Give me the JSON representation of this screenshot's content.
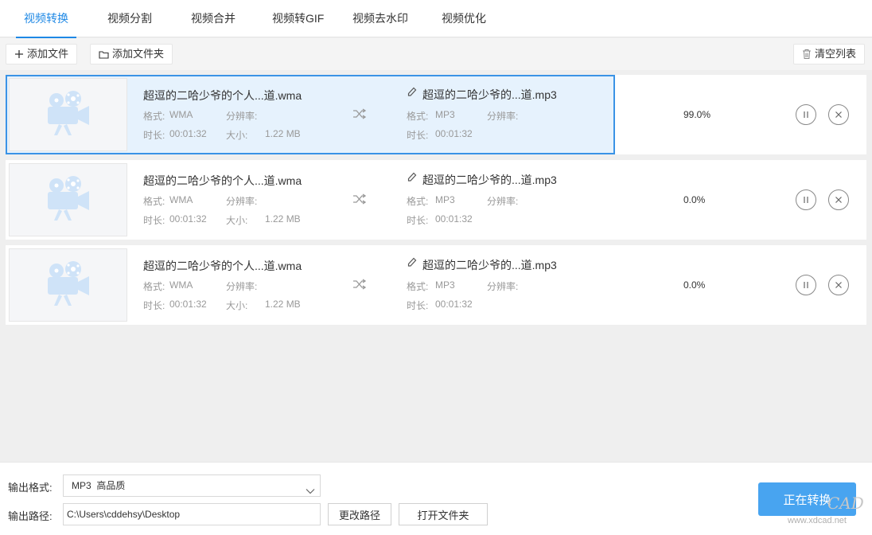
{
  "tabs": [
    {
      "label": "视频转换",
      "active": true
    },
    {
      "label": "视频分割"
    },
    {
      "label": "视频合并"
    },
    {
      "label": "视频转GIF"
    },
    {
      "label": "视频去水印"
    },
    {
      "label": "视频优化"
    }
  ],
  "toolbar": {
    "add_file": "添加文件",
    "add_folder": "添加文件夹",
    "clear_list": "清空列表"
  },
  "items": [
    {
      "source_name": "超逗的二哈少爷的个人...道.wma",
      "format_label": "格式:",
      "format": "WMA",
      "resolution_label": "分辨率:",
      "resolution": "",
      "duration_label": "时长:",
      "duration": "00:01:32",
      "size_label": "大小:",
      "size": "1.22 MB",
      "output_name": "超逗的二哈少爷的...道.mp3",
      "out_format_label": "格式:",
      "out_format": "MP3",
      "out_resolution_label": "分辨率:",
      "out_resolution": "",
      "out_duration_label": "时长:",
      "out_duration": "00:01:32",
      "progress": "99.0%",
      "selected": true
    },
    {
      "source_name": "超逗的二哈少爷的个人...道.wma",
      "format_label": "格式:",
      "format": "WMA",
      "resolution_label": "分辨率:",
      "resolution": "",
      "duration_label": "时长:",
      "duration": "00:01:32",
      "size_label": "大小:",
      "size": "1.22 MB",
      "output_name": "超逗的二哈少爷的...道.mp3",
      "out_format_label": "格式:",
      "out_format": "MP3",
      "out_resolution_label": "分辨率:",
      "out_resolution": "",
      "out_duration_label": "时长:",
      "out_duration": "00:01:32",
      "progress": "0.0%",
      "selected": false
    },
    {
      "source_name": "超逗的二哈少爷的个人...道.wma",
      "format_label": "格式:",
      "format": "WMA",
      "resolution_label": "分辨率:",
      "resolution": "",
      "duration_label": "时长:",
      "duration": "00:01:32",
      "size_label": "大小:",
      "size": "1.22 MB",
      "output_name": "超逗的二哈少爷的...道.mp3",
      "out_format_label": "格式:",
      "out_format": "MP3",
      "out_resolution_label": "分辨率:",
      "out_resolution": "",
      "out_duration_label": "时长:",
      "out_duration": "00:01:32",
      "progress": "0.0%",
      "selected": false
    }
  ],
  "bottom": {
    "format_label": "输出格式:",
    "format_value": "MP3  高品质",
    "path_label": "输出路径:",
    "path_value": "C:\\Users\\cddehsy\\Desktop",
    "change_path": "更改路径",
    "open_folder": "打开文件夹",
    "convert": "正在转换"
  },
  "watermark": {
    "logo": "CAD",
    "url": "www.xdcad.net"
  },
  "colors": {
    "accent": "#1e88e5",
    "selected_bg": "#e6f2fd",
    "convert_btn": "#48a4f0"
  },
  "icons": {
    "add": "plus-icon",
    "folder": "folder-icon",
    "trash": "trash-icon",
    "thumbnail": "film-camera-icon",
    "convert_arrow": "shuffle-icon",
    "rename": "pencil-icon",
    "pause": "pause-icon",
    "remove": "close-icon"
  }
}
